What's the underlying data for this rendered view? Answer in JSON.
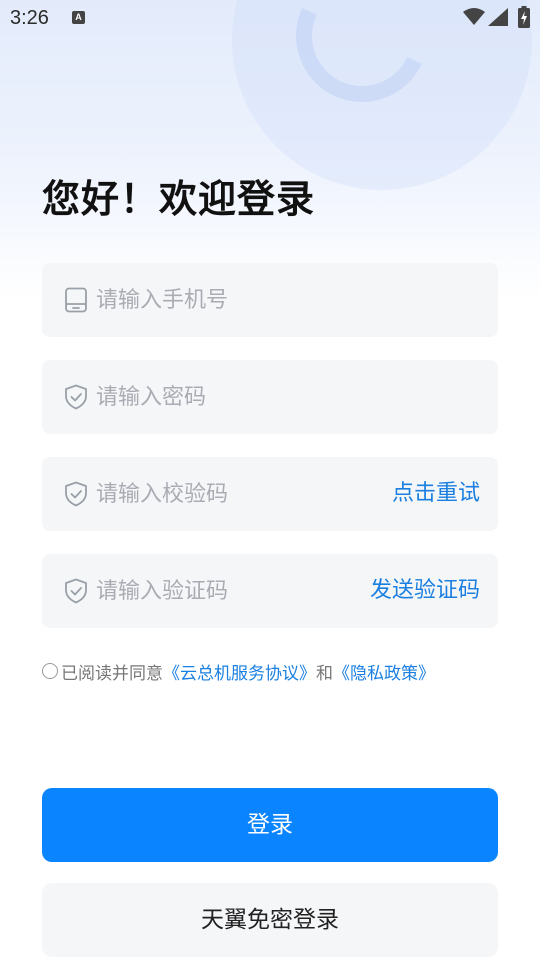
{
  "status_bar": {
    "time": "3:26",
    "notification_icon": "a-letter-icon",
    "wifi_icon": "wifi-icon",
    "signal_icon": "signal-icon",
    "battery_icon": "battery-charging-icon"
  },
  "greeting": "您好！欢迎登录",
  "form": {
    "phone": {
      "placeholder": "请输入手机号",
      "value": "",
      "icon": "phone-icon"
    },
    "password": {
      "placeholder": "请输入密码",
      "value": "",
      "icon": "shield-check-icon"
    },
    "captcha": {
      "placeholder": "请输入校验码",
      "value": "",
      "icon": "shield-check-icon",
      "action": "点击重试"
    },
    "sms_code": {
      "placeholder": "请输入验证码",
      "value": "",
      "icon": "shield-check-icon",
      "action": "发送验证码"
    }
  },
  "agreement": {
    "prefix": "已阅读并同意",
    "service_link": "《云总机服务协议》",
    "and": "和",
    "privacy_link": "《隐私政策》",
    "checked": false
  },
  "buttons": {
    "login": "登录",
    "tianyi_login": "天翼免密登录"
  },
  "colors": {
    "accent": "#0a84ff",
    "link": "#1a7fe0",
    "field_bg": "#f5f6f8",
    "placeholder": "#a9acb3"
  }
}
